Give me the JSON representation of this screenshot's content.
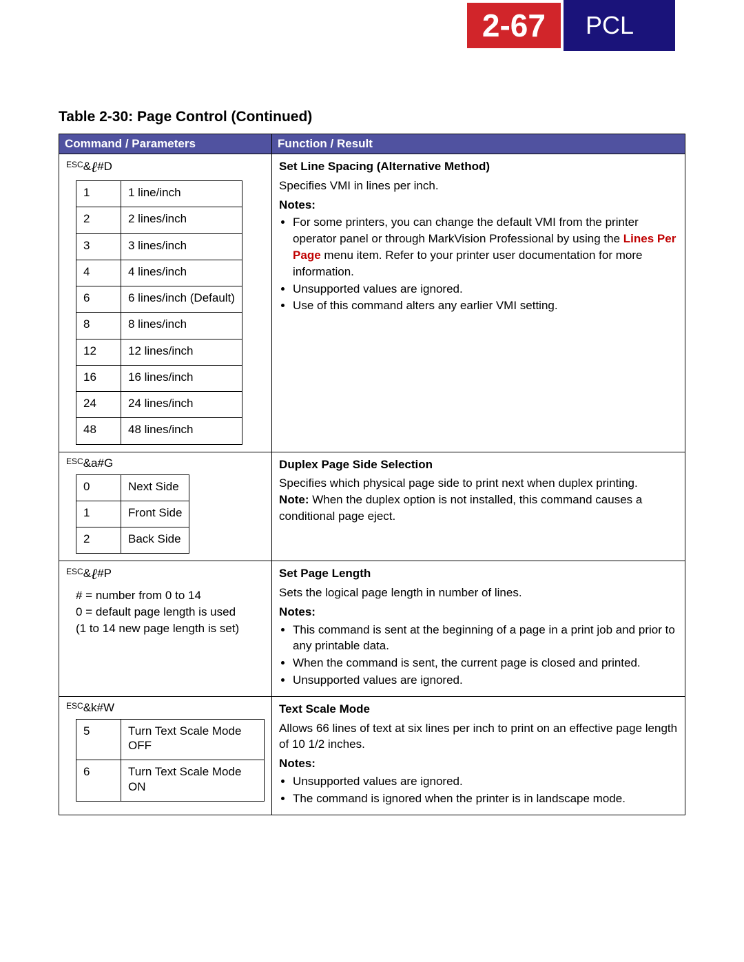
{
  "header": {
    "pageNumber": "2-67",
    "section": "PCL"
  },
  "tableTitle": "Table 2-30:  Page Control (Continued)",
  "columns": {
    "cmd": "Command / Parameters",
    "func": "Function / Result"
  },
  "row1": {
    "escPre": "ESC",
    "escAmp": "&",
    "escEll": "ℓ",
    "escSuf": "#D",
    "params": [
      [
        "1",
        "1 line/inch"
      ],
      [
        "2",
        "2 lines/inch"
      ],
      [
        "3",
        "3 lines/inch"
      ],
      [
        "4",
        "4 lines/inch"
      ],
      [
        "6",
        "6 lines/inch (Default)"
      ],
      [
        "8",
        "8 lines/inch"
      ],
      [
        "12",
        "12 lines/inch"
      ],
      [
        "16",
        "16 lines/inch"
      ],
      [
        "24",
        "24 lines/inch"
      ],
      [
        "48",
        "48 lines/inch"
      ]
    ],
    "title": "Set Line Spacing (Alternative Method)",
    "desc": "Specifies VMI in lines per inch.",
    "notesLabel": "Notes:",
    "note1a": "For some printers, you can change the default VMI from the printer operator panel or through MarkVision Professional by using the ",
    "note1link": "Lines Per Page",
    "note1b": " menu item. Refer to your printer user documentation for more information.",
    "note2": "Unsupported values are ignored.",
    "note3": "Use of this command alters any earlier VMI setting."
  },
  "row2": {
    "escPre": "ESC",
    "escAmp": "&",
    "escRest": "a#G",
    "params": [
      [
        "0",
        "Next Side"
      ],
      [
        "1",
        "Front Side"
      ],
      [
        "2",
        "Back Side"
      ]
    ],
    "title": "Duplex Page Side Selection",
    "desc": "Specifies which physical page side to print next when duplex printing.",
    "noteHead": "Note:",
    "noteBody": " When the duplex option is not installed, this command causes a conditional page eject."
  },
  "row3": {
    "escPre": "ESC",
    "escAmp": "&",
    "escEll": "ℓ",
    "escSuf": "#P",
    "p1": "# = number from 0 to 14",
    "p2": "0 = default page length is used",
    "p3": "(1 to 14 new page length is set)",
    "title": "Set Page Length",
    "desc": "Sets the logical page length in number of lines.",
    "notesLabel": "Notes:",
    "note1": "This command is sent at the beginning of a page in a print job and prior to any printable data.",
    "note2": "When the command is sent, the current page is closed and printed.",
    "note3": "Unsupported values are ignored."
  },
  "row4": {
    "escPre": "ESC",
    "escAmp": "&",
    "escRest": "k#W",
    "params": [
      [
        "5",
        "Turn Text Scale Mode OFF"
      ],
      [
        "6",
        "Turn Text Scale Mode ON"
      ]
    ],
    "title": "Text Scale Mode",
    "desc": "Allows 66 lines of text at six lines per inch to print on an effective page length of 10 1/2 inches.",
    "notesLabel": "Notes:",
    "note1": "Unsupported values are ignored.",
    "note2": "The command is ignored when the printer is in landscape mode."
  }
}
